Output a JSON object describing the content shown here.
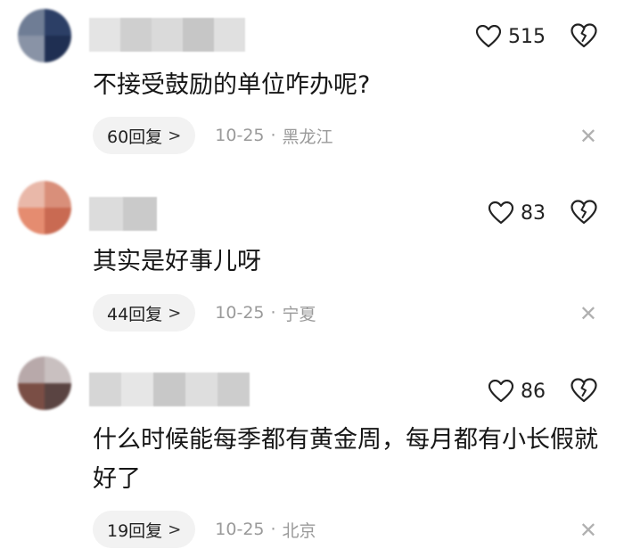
{
  "comments": [
    {
      "text": "不接受鼓励的单位咋办呢?",
      "likes": "515",
      "reply_label": "60回复",
      "reply_chevron": ">",
      "time": "10-25",
      "separator": "·",
      "location": "黑龙江",
      "close_glyph": "✕"
    },
    {
      "text": "其实是好事儿呀",
      "likes": "83",
      "reply_label": "44回复",
      "reply_chevron": ">",
      "time": "10-25",
      "separator": "·",
      "location": "宁夏",
      "close_glyph": "✕"
    },
    {
      "text": "什么时候能每季都有黄金周，每月都有小长假就好了",
      "likes": "86",
      "reply_label": "19回复",
      "reply_chevron": ">",
      "time": "10-25",
      "separator": "·",
      "location": "北京",
      "close_glyph": "✕"
    }
  ],
  "icons": {
    "like": "heart-outline-icon",
    "dislike": "broken-heart-icon",
    "close": "close-icon"
  },
  "colors": {
    "pill_bg": "#f2f2f2",
    "meta_text": "#9a9a9a",
    "body_text": "#161616"
  }
}
